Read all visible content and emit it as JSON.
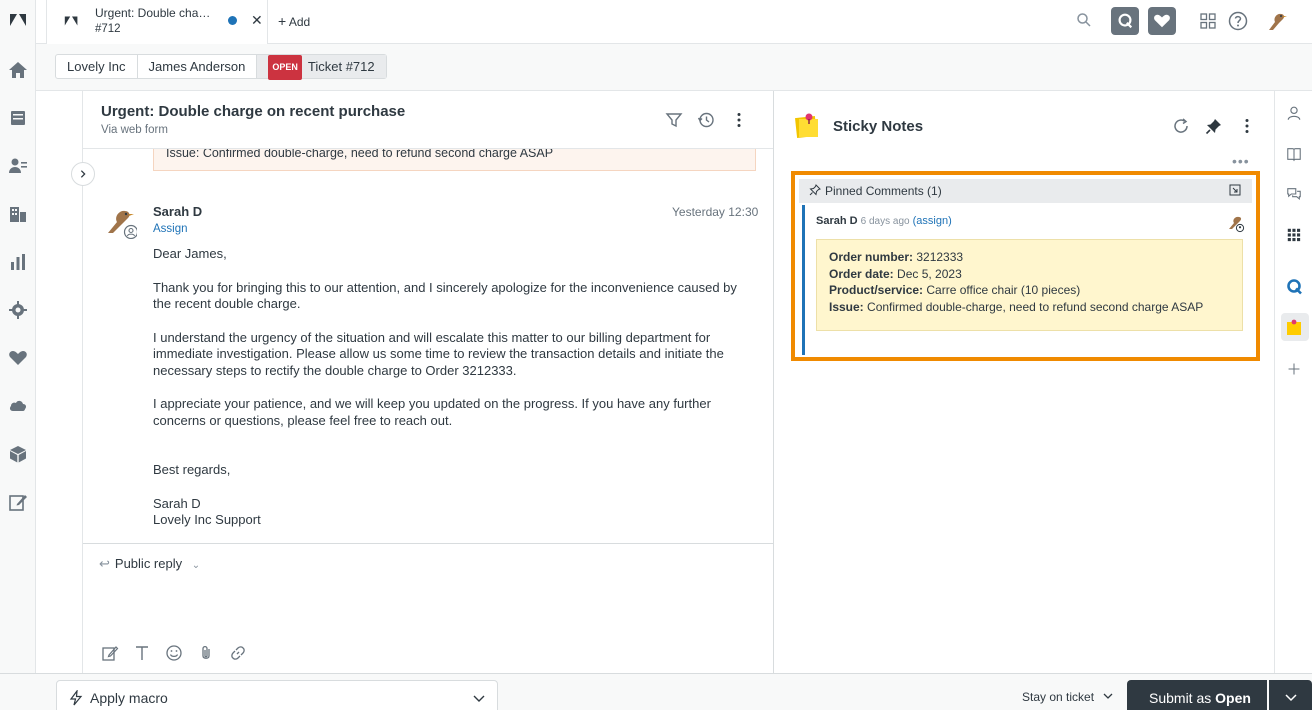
{
  "tab": {
    "title": "Urgent: Double charge on recent purchase",
    "number": "#712",
    "add_label": "Add"
  },
  "breadcrumbs": {
    "org": "Lovely Inc",
    "requester": "James Anderson",
    "status_badge": "OPEN",
    "ticket": "Ticket #712"
  },
  "ticket": {
    "title": "Urgent: Double charge on recent purchase",
    "channel": "Via web form",
    "previous_note": "Issue: Confirmed double-charge, need to refund second charge ASAP"
  },
  "message": {
    "author": "Sarah D",
    "time": "Yesterday 12:30",
    "assign": "Assign",
    "greeting": "Dear James,",
    "para1": "Thank you for bringing this to our attention, and I sincerely apologize for the inconvenience caused by the recent double charge.",
    "para2": "I understand the urgency of the situation and will escalate this matter to our billing department for immediate investigation. Please allow us some time to review the transaction details and initiate the necessary steps to rectify the double charge to Order 3212333.",
    "para3": "I appreciate your patience, and we will keep you updated on the progress. If you have any further concerns or questions, please feel free to reach out.",
    "closing": "Best regards,",
    "signature_name": "Sarah D",
    "signature_team": "Lovely Inc Support"
  },
  "reply": {
    "type": "Public reply"
  },
  "sticky": {
    "title": "Sticky Notes",
    "pinned_label": "Pinned Comments (1)",
    "comment": {
      "author": "Sarah D",
      "time": "6 days ago",
      "assign": "(assign)",
      "order_number_label": "Order number:",
      "order_number": "3212333",
      "order_date_label": "Order date:",
      "order_date": "Dec 5, 2023",
      "product_label": "Product/service:",
      "product": "Carre office chair (10 pieces)",
      "issue_label": "Issue:",
      "issue": "Confirmed double-charge, need to refund second charge ASAP"
    }
  },
  "footer": {
    "macro": "Apply macro",
    "stay": "Stay on ticket",
    "submit_prefix": "Submit as",
    "submit_status": "Open"
  },
  "colors": {
    "highlight_border": "#f08a00",
    "brand_dark": "#2f3941",
    "link_blue": "#1f73b7",
    "open_red": "#cc3340",
    "note_yellow": "#fff6ce"
  },
  "icons": {
    "left_nav": [
      "zendesk-logo-icon",
      "home-icon",
      "views-icon",
      "customers-icon",
      "organizations-icon",
      "reporting-icon",
      "admin-icon",
      "heart-handshake-icon",
      "cloud-icon",
      "box-icon",
      "edit-icon",
      "zendesk-z-icon"
    ],
    "right_rail": [
      "user-icon",
      "knowledge-book-icon",
      "chat-icon",
      "apps-grid-icon",
      "q-app-icon",
      "sticky-notes-icon",
      "plus-icon"
    ]
  }
}
